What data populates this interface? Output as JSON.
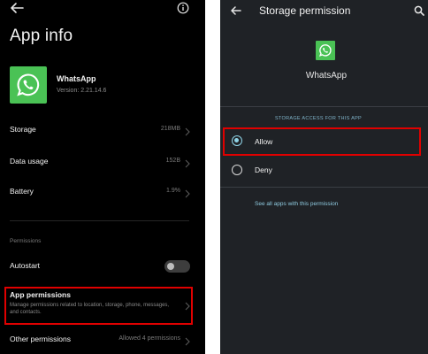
{
  "app_info": {
    "title": "App info",
    "app_name": "WhatsApp",
    "version": "Version: 2.21.14.6",
    "rows": [
      {
        "label": "Storage",
        "value": "218MB"
      },
      {
        "label": "Data usage",
        "value": "152B"
      },
      {
        "label": "Battery",
        "value": "1.9%"
      }
    ],
    "permissions_section": "Permissions",
    "autostart_label": "Autostart",
    "autostart_enabled": false,
    "app_permissions_title": "App permissions",
    "app_permissions_desc": "Manage permissions related to location, storage, phone, messages, and contacts.",
    "other_permissions_label": "Other permissions",
    "other_permissions_value": "Allowed 4 permissions",
    "icons": [
      "back-arrow-icon",
      "info-icon",
      "whatsapp-icon",
      "chevron-right-icon"
    ]
  },
  "storage_permission": {
    "title": "Storage permission",
    "app_name": "WhatsApp",
    "section_label": "STORAGE ACCESS FOR THIS APP",
    "options": [
      {
        "label": "Allow",
        "selected": true
      },
      {
        "label": "Deny",
        "selected": false
      }
    ],
    "link": "See all apps with this permission",
    "icons": [
      "back-arrow-icon",
      "search-icon",
      "whatsapp-icon"
    ]
  },
  "colors": {
    "whatsapp_green": "#4ac255",
    "highlight_red": "#e00000",
    "accent_teal": "#8fd3e6"
  }
}
